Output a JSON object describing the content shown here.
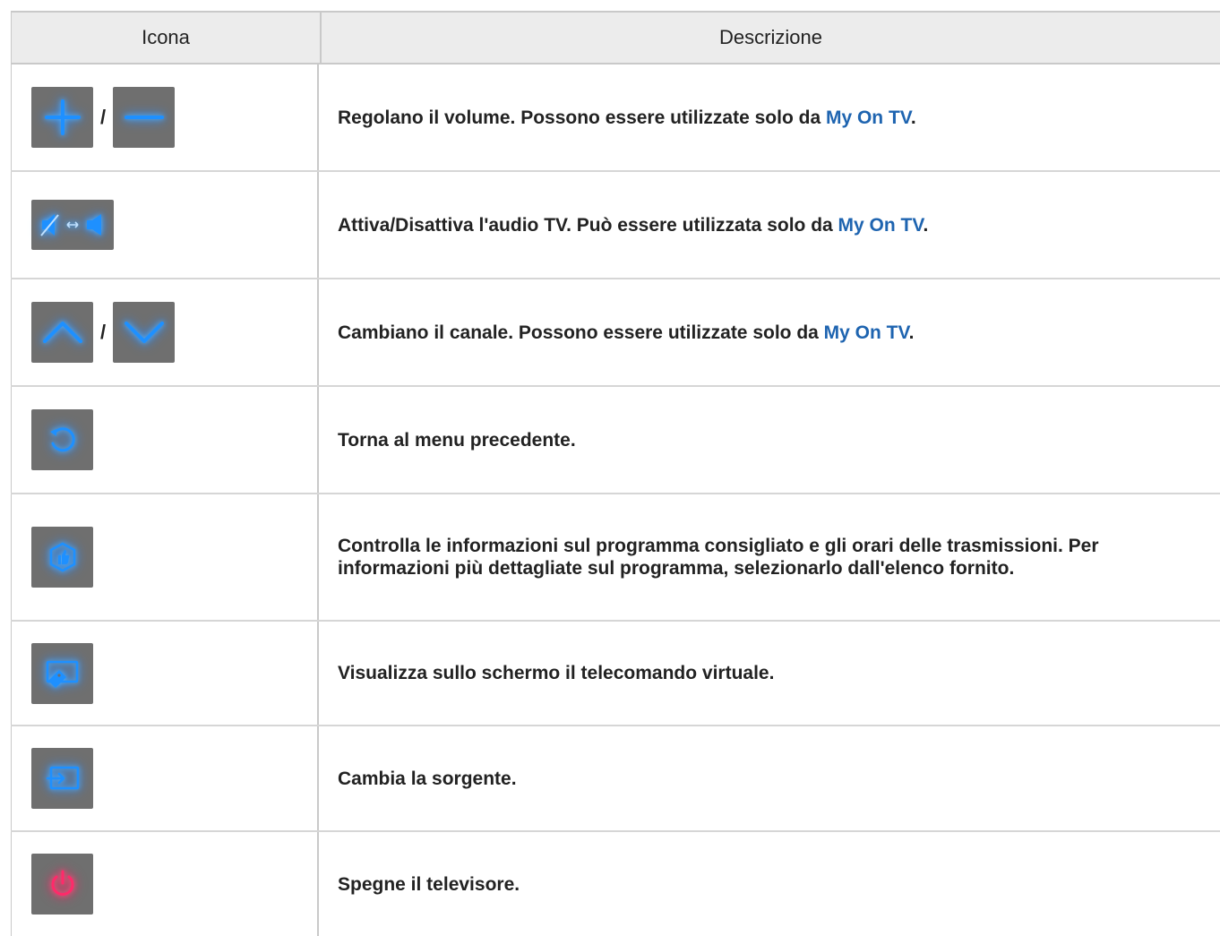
{
  "header": {
    "col_icon": "Icona",
    "col_desc": "Descrizione"
  },
  "slash": "/",
  "rows": [
    {
      "icons": [
        "plus-icon",
        "minus-icon"
      ],
      "desc_pre": "Regolano il volume. Possono essere utilizzate solo da ",
      "link": "My On TV",
      "desc_post": "."
    },
    {
      "icons": [
        "mute-toggle-icon"
      ],
      "desc_pre": "Attiva/Disattiva l'audio TV. Può essere utilizzata solo da ",
      "link": "My On TV",
      "desc_post": "."
    },
    {
      "icons": [
        "chevron-up-icon",
        "chevron-down-icon"
      ],
      "desc_pre": "Cambiano il canale. Possono essere utilizzate solo da ",
      "link": "My On TV",
      "desc_post": "."
    },
    {
      "icons": [
        "return-icon"
      ],
      "desc": "Torna al menu precedente."
    },
    {
      "icons": [
        "recommended-icon"
      ],
      "desc": "Controlla le informazioni sul programma consigliato e gli orari delle trasmissioni. Per informazioni più dettagliate sul programma, selezionarlo dall'elenco fornito."
    },
    {
      "icons": [
        "virtual-remote-icon"
      ],
      "desc": "Visualizza sullo schermo il telecomando virtuale."
    },
    {
      "icons": [
        "source-icon"
      ],
      "desc": "Cambia la sorgente."
    },
    {
      "icons": [
        "power-icon"
      ],
      "desc": "Spegne il televisore."
    }
  ],
  "colors": {
    "accent_blue": "#2a8cff",
    "power_red": "#ff2060",
    "link": "#1e64b0",
    "button_bg": "#6f6f6f"
  }
}
